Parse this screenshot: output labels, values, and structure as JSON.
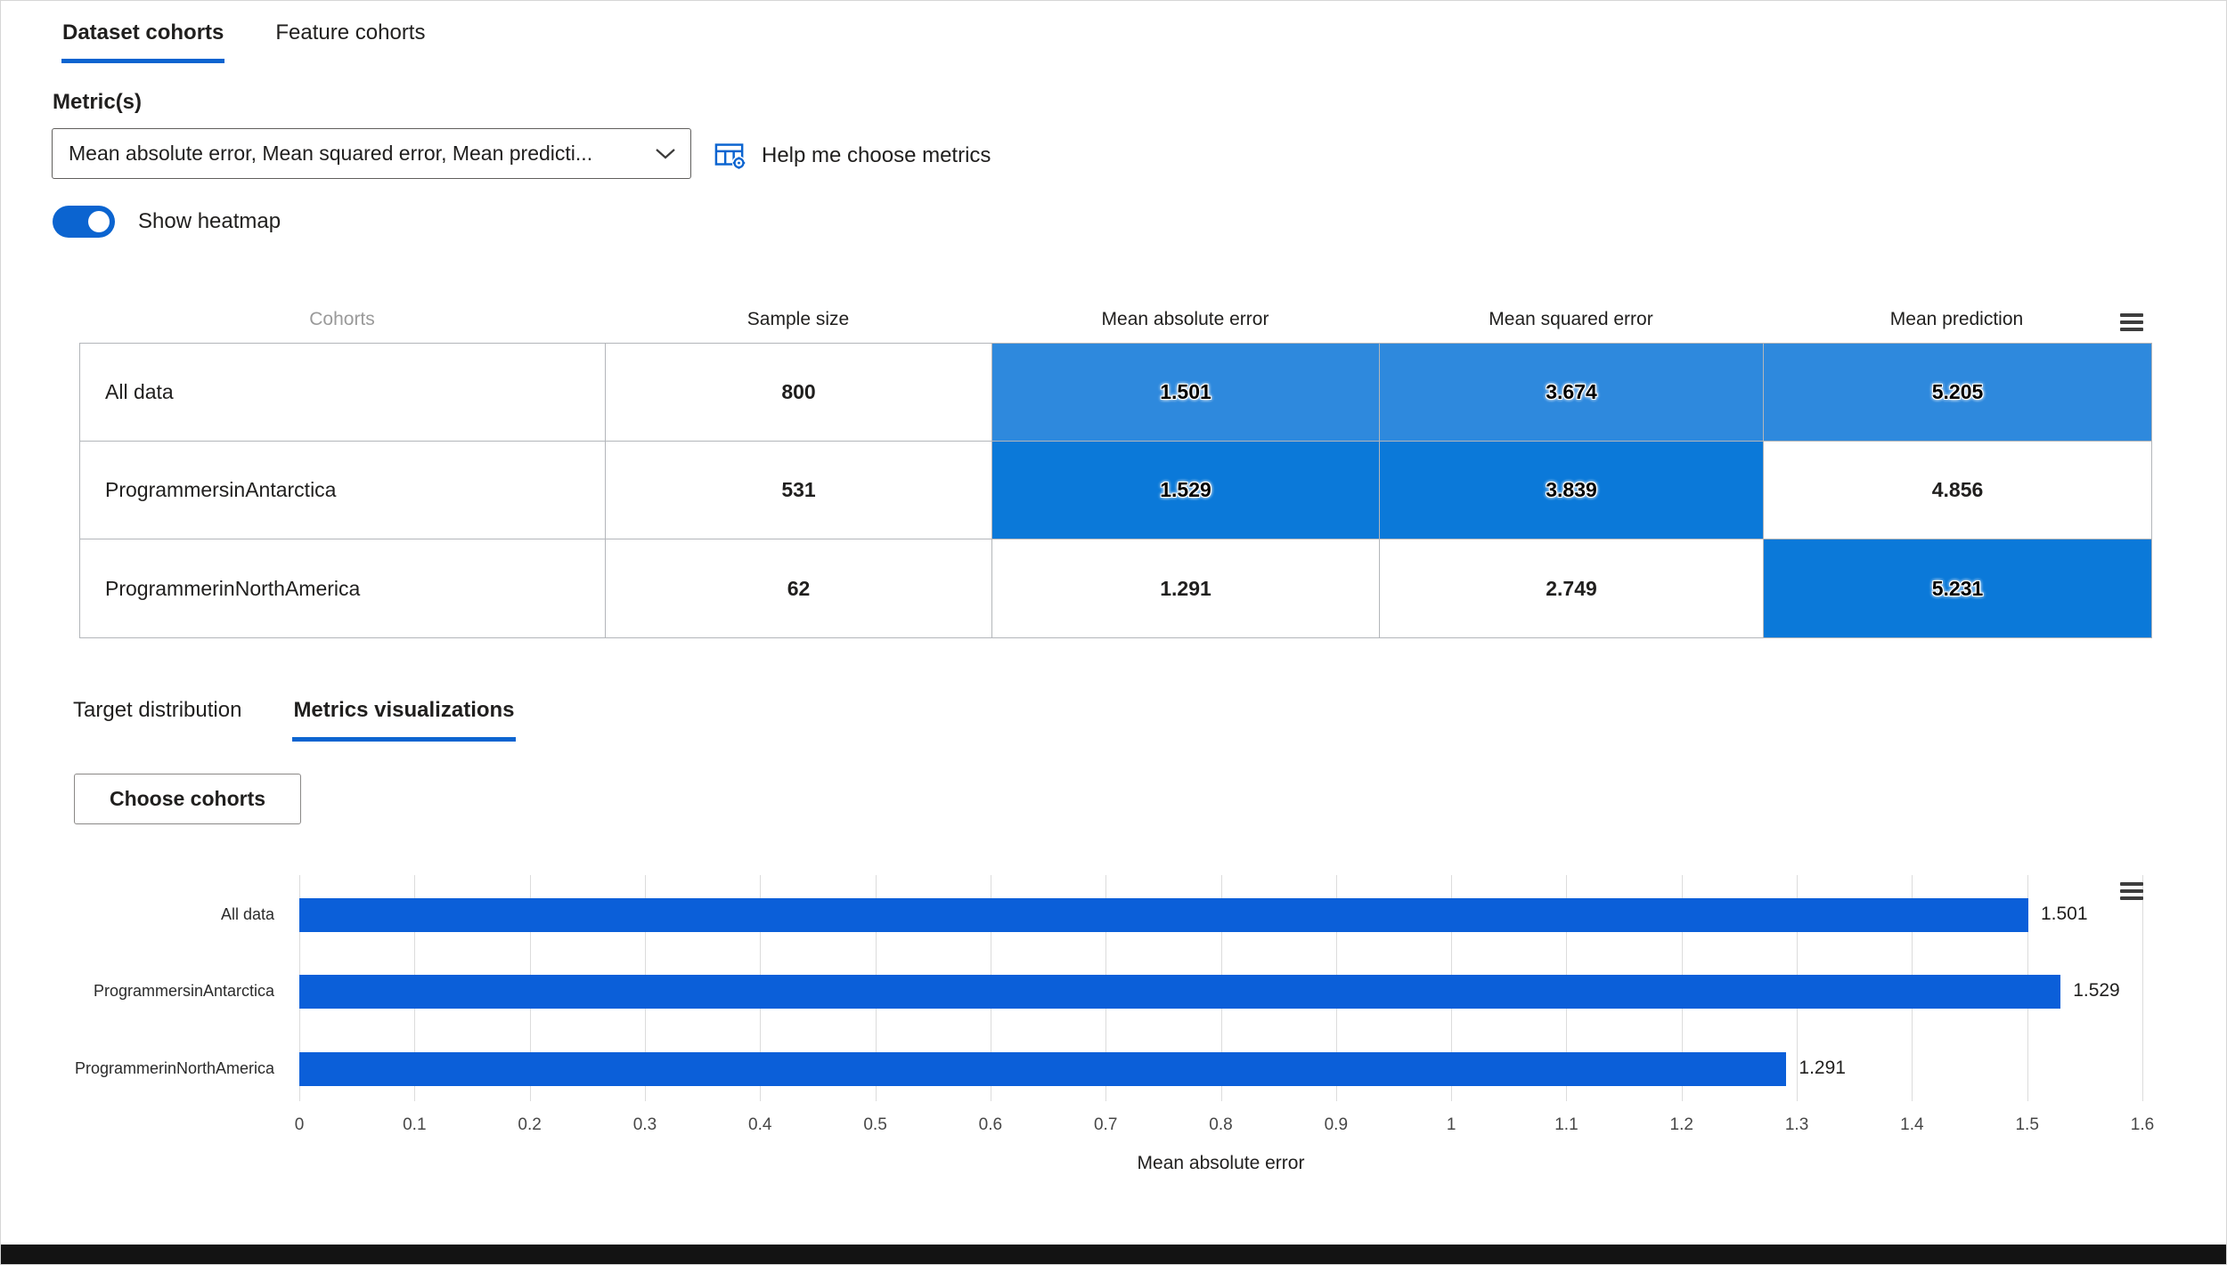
{
  "page": {
    "accent": "#0b64d0",
    "footer_color": "#131313"
  },
  "icons": {
    "dropdown_chevron": "chevron-down",
    "help_metrics": "table-settings",
    "table_menu": "hamburger-menu",
    "chart_menu": "hamburger-menu"
  },
  "tabs": [
    {
      "label": "Dataset cohorts",
      "active": true
    },
    {
      "label": "Feature cohorts",
      "active": false
    }
  ],
  "metrics_section": {
    "label": "Metric(s)",
    "dropdown_value": "Mean absolute error, Mean squared error, Mean predicti...",
    "help_button": "Help me choose metrics"
  },
  "heatmap_toggle": {
    "label": "Show heatmap",
    "on": true
  },
  "cohort_table": {
    "columns": [
      "Cohorts",
      "Sample size",
      "Mean absolute error",
      "Mean squared error",
      "Mean prediction"
    ],
    "heat_colors": {
      "light": "#2e89dd",
      "dark": "#0b79d9",
      "none": "#ffffff"
    },
    "rows": [
      {
        "cohort": "All data",
        "sample_size": "800",
        "values": [
          "1.501",
          "3.674",
          "5.205"
        ],
        "heat": [
          "light",
          "light",
          "light"
        ]
      },
      {
        "cohort": "ProgrammersinAntarctica",
        "sample_size": "531",
        "values": [
          "1.529",
          "3.839",
          "4.856"
        ],
        "heat": [
          "dark",
          "dark",
          "none"
        ]
      },
      {
        "cohort": "ProgrammerinNorthAmerica",
        "sample_size": "62",
        "values": [
          "1.291",
          "2.749",
          "5.231"
        ],
        "heat": [
          "none",
          "none",
          "dark"
        ]
      }
    ]
  },
  "subtabs": [
    {
      "label": "Target distribution",
      "active": false
    },
    {
      "label": "Metrics visualizations",
      "active": true
    }
  ],
  "choose_cohorts_button": "Choose cohorts",
  "chart_data": {
    "type": "bar",
    "orientation": "horizontal",
    "categories": [
      "All data",
      "ProgrammersinAntarctica",
      "ProgrammerinNorthAmerica"
    ],
    "values": [
      1.501,
      1.529,
      1.291
    ],
    "value_labels": [
      "1.501",
      "1.529",
      "1.291"
    ],
    "xlabel": "Mean absolute error",
    "xlim": [
      0,
      1.6
    ],
    "xticks": [
      "0",
      "0.1",
      "0.2",
      "0.3",
      "0.4",
      "0.5",
      "0.6",
      "0.7",
      "0.8",
      "0.9",
      "1",
      "1.1",
      "1.2",
      "1.3",
      "1.4",
      "1.5",
      "1.6"
    ],
    "bar_color": "#0b5fd9",
    "grid": true,
    "legend": false
  }
}
